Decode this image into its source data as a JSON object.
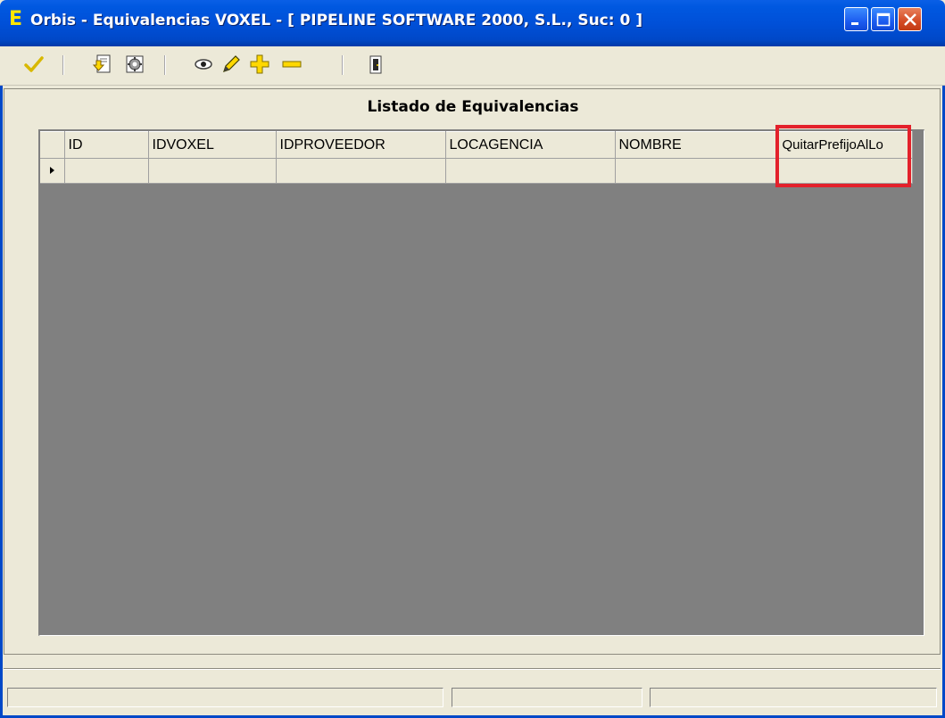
{
  "window": {
    "icon_letter": "E",
    "title": "Orbis - Equivalencias VOXEL - [ PIPELINE SOFTWARE 2000, S.L.,  Suc: 0 ]",
    "controls": [
      "minimize-icon",
      "maximize-icon",
      "close-icon"
    ]
  },
  "toolbar": {
    "buttons": [
      {
        "name": "accept",
        "icon": "checkmark-icon"
      },
      {
        "name": "import",
        "icon": "import-document-icon"
      },
      {
        "name": "process",
        "icon": "gear-document-icon"
      },
      {
        "name": "view",
        "icon": "eye-icon"
      },
      {
        "name": "edit",
        "icon": "pencil-icon"
      },
      {
        "name": "add",
        "icon": "plus-icon"
      },
      {
        "name": "delete",
        "icon": "minus-icon"
      },
      {
        "name": "exit",
        "icon": "door-icon"
      }
    ]
  },
  "panel": {
    "title": "Listado de Equivalencias"
  },
  "grid": {
    "columns": [
      "ID",
      "IDVOXEL",
      "IDPROVEEDOR",
      "LOCAGENCIA",
      "NOMBRE",
      "QuitarPrefijoAlLo"
    ],
    "rows": [
      [
        "",
        "",
        "",
        "",
        "",
        ""
      ]
    ],
    "highlighted_column": "QuitarPrefijoAlLo"
  },
  "statusbar": {
    "panels": [
      "",
      "",
      ""
    ]
  },
  "colors": {
    "titlebar": "#0054e3",
    "highlight_box": "#e3212b",
    "grid_background": "#808080",
    "window_face": "#ece9d8"
  }
}
